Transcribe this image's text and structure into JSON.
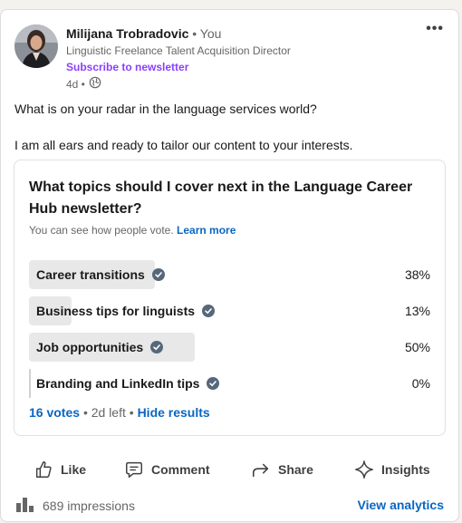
{
  "post": {
    "author": {
      "name": "Milijana Trobradovic",
      "you_label": "• You",
      "headline": "Linguistic Freelance Talent Acquisition Director",
      "subscribe_label": "Subscribe to newsletter",
      "time": "4d •",
      "visibility_icon": "globe-icon"
    },
    "more_icon": "•••",
    "text": {
      "line1": "What is on your radar in the language services world?",
      "line2": "I am all ears and ready to tailor our content to your interests."
    }
  },
  "poll": {
    "question": "What topics should I cover next in the Language Career Hub newsletter?",
    "note": "You can see how people vote.",
    "learn_more": "Learn more",
    "options": [
      {
        "label": "Career transitions",
        "percent": "38%",
        "fraction": 0.38,
        "voted_icon": "check-icon"
      },
      {
        "label": "Business tips for linguists",
        "percent": "13%",
        "fraction": 0.13,
        "voted_icon": "check-icon"
      },
      {
        "label": "Job opportunities",
        "percent": "50%",
        "fraction": 0.5,
        "voted_icon": "check-icon"
      },
      {
        "label": "Branding and LinkedIn tips",
        "percent": "0%",
        "fraction": 0.0,
        "voted_icon": "check-icon"
      }
    ],
    "votes": "16 votes",
    "separator1": "•",
    "time_left": "2d left",
    "separator2": "•",
    "hide_results": "Hide results"
  },
  "actions": {
    "like": "Like",
    "comment": "Comment",
    "share": "Share",
    "insights": "Insights"
  },
  "footer": {
    "impressions": "689 impressions",
    "view_analytics": "View analytics"
  },
  "colors": {
    "accent": "#0a66c2",
    "subscribe": "#8a3ffc",
    "bar_fill": "#e8e8e8"
  }
}
